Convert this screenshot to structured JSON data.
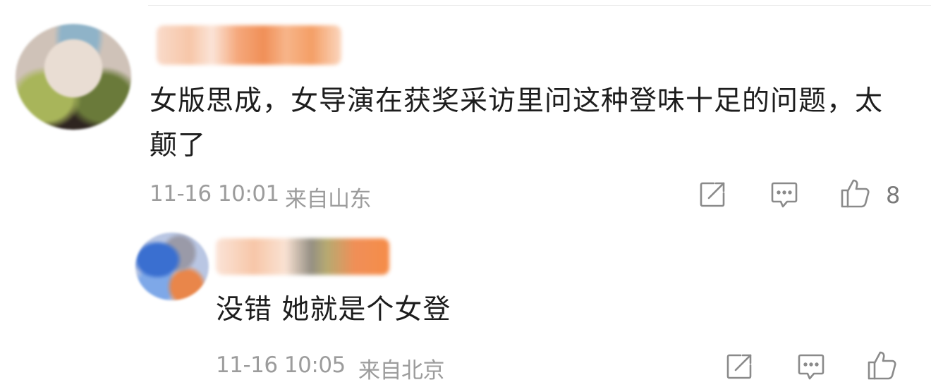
{
  "comments": [
    {
      "content": "女版思成，女导演在获奖采访里问这种登味十足的问题，太颠了",
      "time": "11-16 10:01",
      "location": "来自山东",
      "likes": "8",
      "icons": [
        "share-icon",
        "comment-icon",
        "like-icon"
      ]
    },
    {
      "content": "没错 她就是个女登",
      "time": "11-16 10:05",
      "location": "来自北京",
      "icons": [
        "share-icon",
        "comment-icon",
        "like-icon"
      ]
    }
  ],
  "colors": {
    "meta_text": "#9c9c9c",
    "icon_stroke": "#8a8a8a",
    "content_text": "#1d1d1d"
  }
}
